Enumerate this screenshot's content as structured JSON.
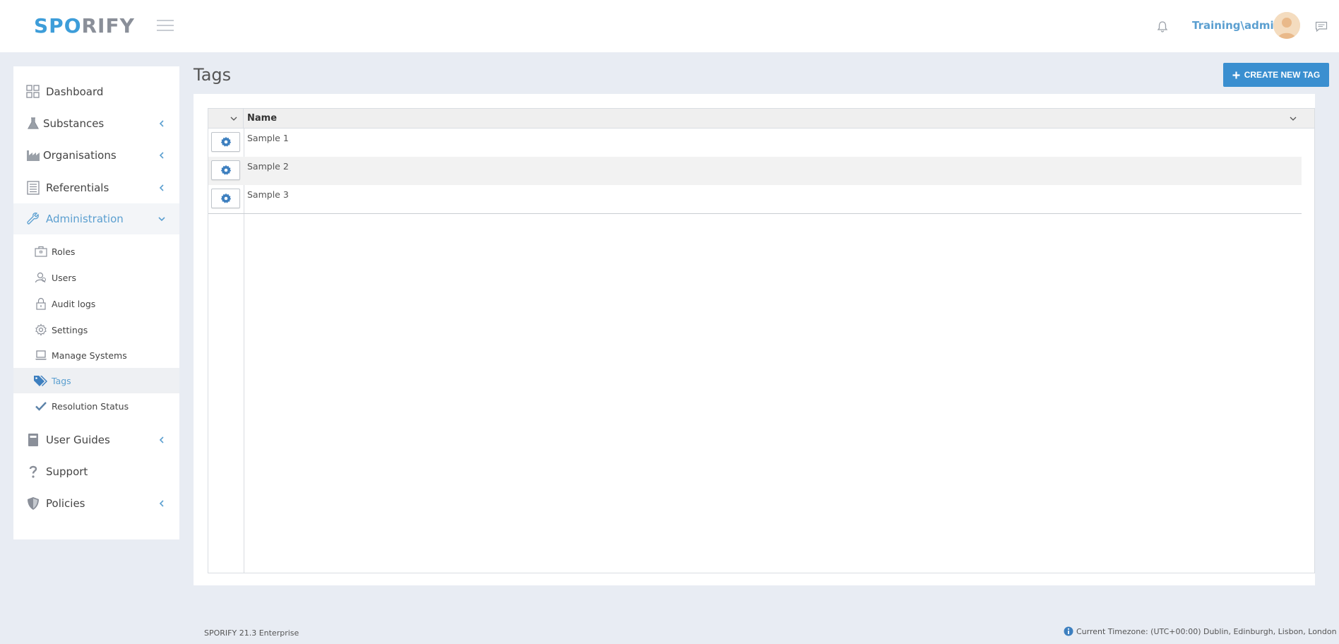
{
  "app": {
    "logo_part1": "SP",
    "logo_part2": "O",
    "logo_part3": "RIFY"
  },
  "header": {
    "username": "Training\\admin"
  },
  "sidebar": {
    "items": [
      {
        "label": "Dashboard",
        "icon": "dashboard-icon"
      },
      {
        "label": "Substances",
        "icon": "flask-icon"
      },
      {
        "label": "Organisations",
        "icon": "industry-icon"
      },
      {
        "label": "Referentials",
        "icon": "list-icon"
      },
      {
        "label": "Administration",
        "icon": "wrench-icon"
      },
      {
        "label": "User Guides",
        "icon": "book-icon"
      },
      {
        "label": "Support",
        "icon": "question-icon"
      },
      {
        "label": "Policies",
        "icon": "shield-icon"
      }
    ],
    "admin_sub": [
      {
        "label": "Roles",
        "icon": "briefcase-icon"
      },
      {
        "label": "Users",
        "icon": "users-icon"
      },
      {
        "label": "Audit logs",
        "icon": "lock-icon"
      },
      {
        "label": "Settings",
        "icon": "gear-icon"
      },
      {
        "label": "Manage Systems",
        "icon": "laptop-icon"
      },
      {
        "label": "Tags",
        "icon": "tags-icon"
      },
      {
        "label": "Resolution Status",
        "icon": "check-icon"
      }
    ]
  },
  "main": {
    "title": "Tags",
    "create_button": "CREATE NEW TAG",
    "table": {
      "column_name": "Name",
      "rows": [
        "Sample 1",
        "Sample 2",
        "Sample 3"
      ]
    }
  },
  "footer": {
    "version": "SPORIFY 21.3 Enterprise",
    "timezone": "Current Timezone: (UTC+00:00) Dublin, Edinburgh, Lisbon, London"
  },
  "colors": {
    "accent": "#3a8fd0",
    "link": "#5b9fd0",
    "background": "#e8ecf3"
  }
}
